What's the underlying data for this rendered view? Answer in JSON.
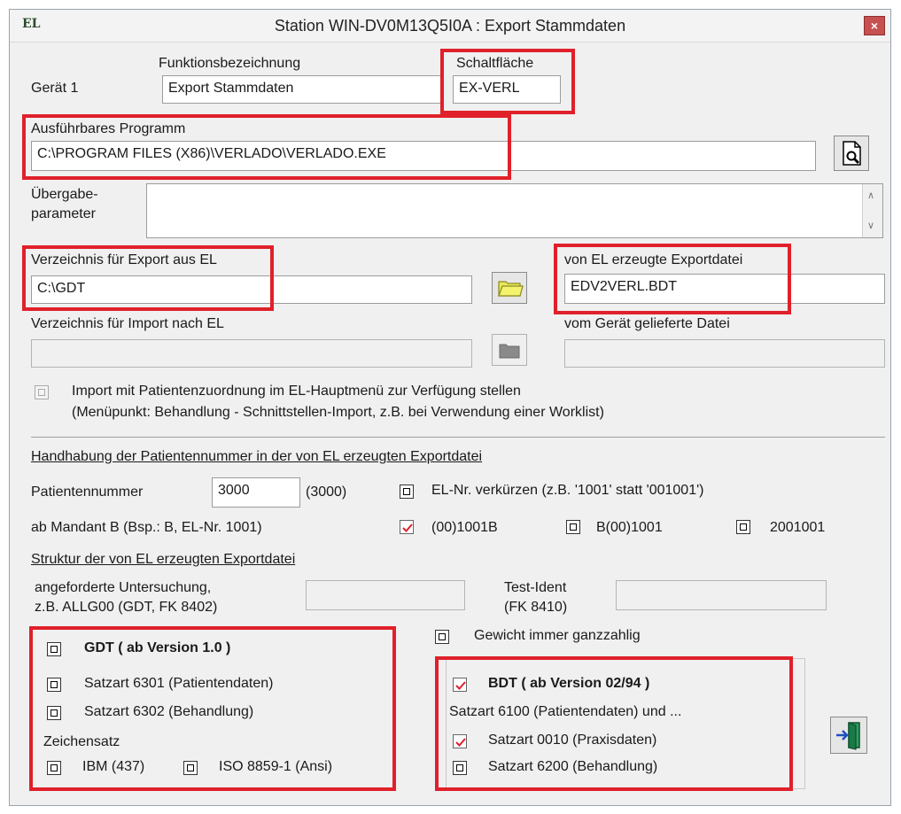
{
  "window": {
    "title": "Station WIN-DV0M13Q5I0A : Export Stammdaten",
    "app_icon_text": "EL",
    "close_glyph": "×"
  },
  "header": {
    "geraet_label": "Gerät 1",
    "funktion_label": "Funktionsbezeichnung",
    "funktion_value": "Export Stammdaten",
    "schalt_label": "Schaltfläche",
    "schalt_value": "EX-VERL"
  },
  "program": {
    "label": "Ausführbares Programm",
    "value": "C:\\PROGRAM FILES (X86)\\VERLADO\\VERLADO.EXE"
  },
  "params": {
    "label_line1": "Übergabe-",
    "label_line2": "parameter",
    "value": ""
  },
  "export_dir": {
    "label": "Verzeichnis für Export aus EL",
    "value": "C:\\GDT"
  },
  "export_file": {
    "label": "von EL erzeugte Exportdatei",
    "value": "EDV2VERL.BDT"
  },
  "import_dir": {
    "label": "Verzeichnis für Import nach EL",
    "value": ""
  },
  "import_file": {
    "label": "vom Gerät gelieferte Datei",
    "value": ""
  },
  "import_option": {
    "line1": "Import mit Patientenzuordnung im EL-Hauptmenü zur Verfügung stellen",
    "line2": "(Menüpunkt: Behandlung - Schnittstellen-Import, z.B. bei Verwendung einer Worklist)"
  },
  "handling": {
    "heading": "Handhabung der Patientennummer in der von EL erzeugten Exportdatei",
    "patnr_label": "Patientennummer",
    "patnr_value": "3000",
    "patnr_hint": "(3000)",
    "shorten_label": "EL-Nr. verkürzen (z.B. '1001' statt '001001')",
    "mandant_label": "ab Mandant B (Bsp.: B, EL-Nr. 1001)",
    "opt1": "(00)1001B",
    "opt2": "B(00)1001",
    "opt3": "2001001"
  },
  "structure": {
    "heading": "Struktur der von EL erzeugten Exportdatei",
    "untersuchung_line1": "angeforderte Untersuchung,",
    "untersuchung_line2": "z.B. ALLG00 (GDT, FK 8402)",
    "testident_line1": "Test-Ident",
    "testident_line2": "(FK 8410)",
    "gewicht_label": "Gewicht immer ganzzahlig"
  },
  "gdt": {
    "title": "GDT ( ab Version 1.0 )",
    "s6301": "Satzart 6301 (Patientendaten)",
    "s6302": "Satzart 6302 (Behandlung)",
    "zeichensatz": "Zeichensatz",
    "ibm": "IBM (437)",
    "iso": "ISO 8859-1 (Ansi)"
  },
  "bdt": {
    "title": "BDT ( ab Version 02/94 )",
    "s6100": "Satzart 6100 (Patientendaten) und ...",
    "s0010": "Satzart 0010 (Praxisdaten)",
    "s6200": "Satzart 6200 (Behandlung)"
  }
}
